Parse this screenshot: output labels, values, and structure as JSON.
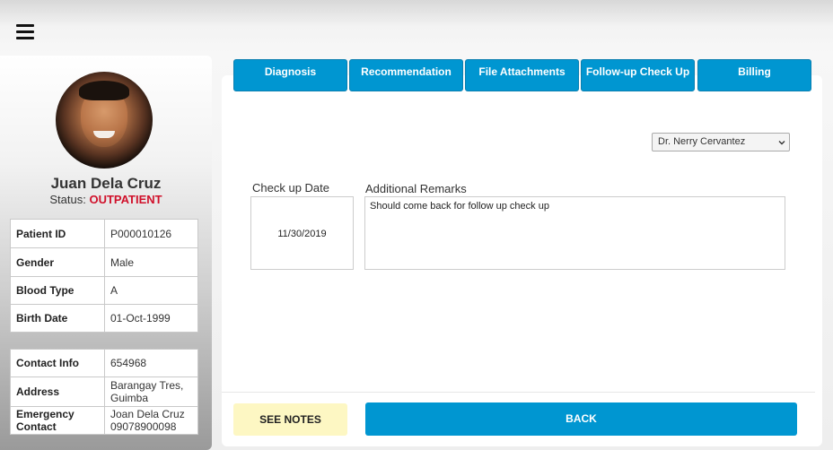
{
  "header": {
    "menu_icon": "hamburger-menu-icon"
  },
  "patient": {
    "name": "Juan Dela Cruz",
    "status_label": "Status:",
    "status_value": "OUTPATIENT",
    "details": [
      {
        "label": "Patient ID",
        "value": "P000010126"
      },
      {
        "label": "Gender",
        "value": "Male"
      },
      {
        "label": "Blood Type",
        "value": "A"
      },
      {
        "label": "Birth Date",
        "value": "01-Oct-1999"
      }
    ],
    "contact": {
      "contact_info_label": "Contact Info",
      "contact_info_value": "654968",
      "address_label": "Address",
      "address_line1": "Barangay Tres,",
      "address_line2": "Guimba",
      "emergency_label_line1": "Emergency",
      "emergency_label_line2": "Contact",
      "emergency_name": "Joan Dela Cruz",
      "emergency_phone": "09078900098"
    }
  },
  "tabs": [
    {
      "label": "Diagnosis"
    },
    {
      "label": "Recommendation"
    },
    {
      "label": "File Attachments"
    },
    {
      "label": "Follow-up Check Up"
    },
    {
      "label": "Billing"
    }
  ],
  "doctor_select": {
    "selected": "Dr. Nerry Cervantez"
  },
  "form": {
    "checkup_date_label": "Check up Date",
    "checkup_date_value": "11/30/2019",
    "remarks_label": "Additional Remarks",
    "remarks_value": "Should come back for follow up check up"
  },
  "actions": {
    "see_notes": "SEE NOTES",
    "back": "BACK"
  },
  "colors": {
    "accent": "#0096d1",
    "status": "#d0102a",
    "notes_bg": "#fdf7c3"
  }
}
